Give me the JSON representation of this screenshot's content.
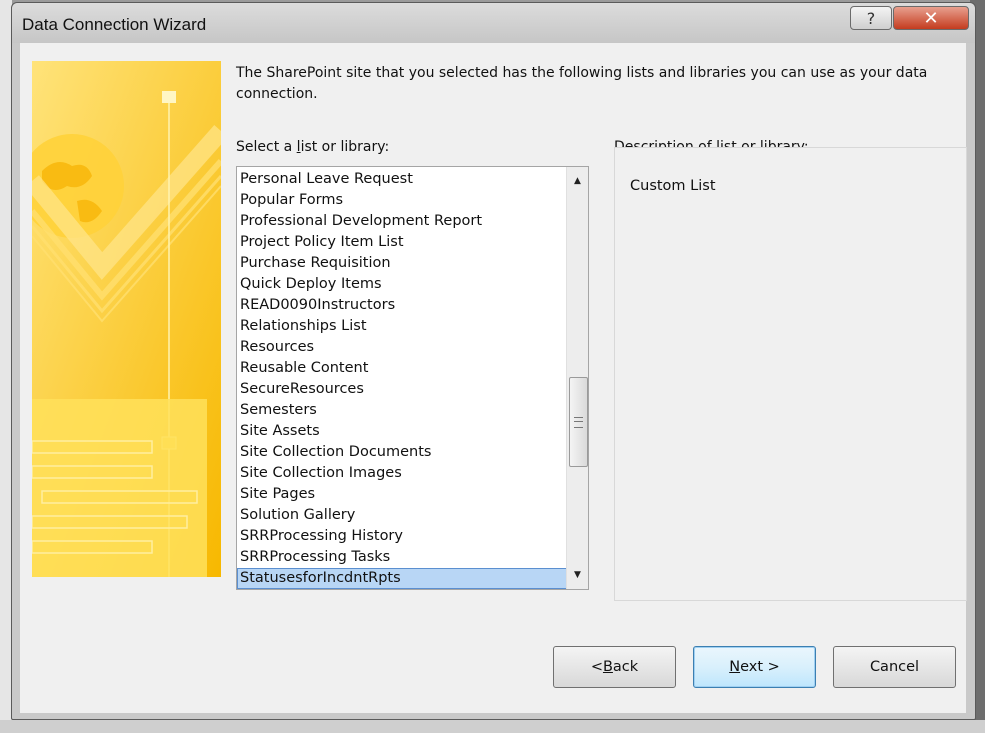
{
  "window": {
    "title": "Data Connection Wizard",
    "help_label": "?",
    "close_label": "✕"
  },
  "intro_text": "The SharePoint site that you selected has the following lists and libraries you can use as your data connection.",
  "list": {
    "label_pre": "Select a ",
    "label_accel": "l",
    "label_post": "ist or library:",
    "items": [
      "Personal Leave Request",
      "Popular Forms",
      "Professional Development Report",
      "Project Policy Item List",
      "Purchase Requisition",
      "Quick Deploy Items",
      "READ0090Instructors",
      "Relationships List",
      "Resources",
      "Reusable Content",
      "SecureResources",
      "Semesters",
      "Site Assets",
      "Site Collection Documents",
      "Site Collection Images",
      "Site Pages",
      "Solution Gallery",
      "SRRProcessing History",
      "SRRProcessing Tasks",
      "StatusesforIncdntRpts"
    ],
    "selected_index": 19,
    "scroll_position": 0.55
  },
  "description": {
    "label": "Description of list or library:",
    "value": "Custom List"
  },
  "buttons": {
    "back_pre": "< ",
    "back_accel": "B",
    "back_post": "ack",
    "next_accel": "N",
    "next_post": "ext >",
    "cancel": "Cancel"
  },
  "colors": {
    "banner": "#fdc30a",
    "selection": "#b8d6f5",
    "close_button": "#c43c1f"
  }
}
